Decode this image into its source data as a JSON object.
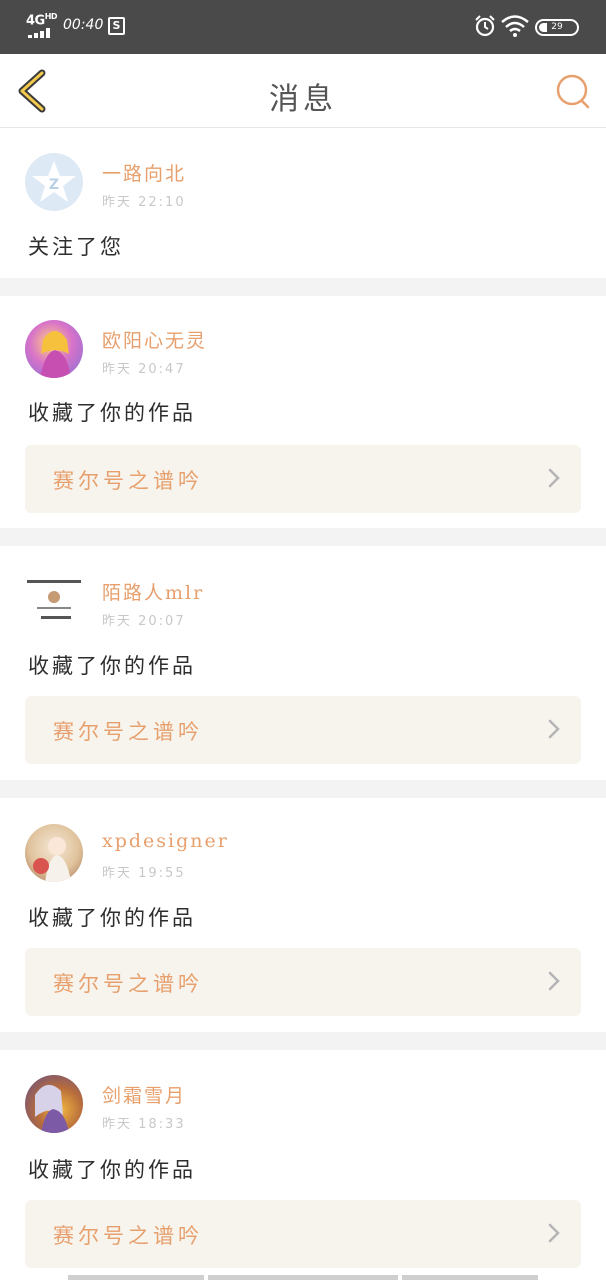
{
  "status_bar": {
    "network": "4G",
    "network_sup": "HD",
    "time": "00:40",
    "s_icon": "S",
    "battery": "29"
  },
  "nav": {
    "title": "消息",
    "back_icon": "chevron-left-icon",
    "search_icon": "search-icon"
  },
  "messages": [
    {
      "user": "一路向北",
      "time": "昨天 22:10",
      "action": "关注了您",
      "avatar_icon": "qzone-star-icon"
    },
    {
      "user": "欧阳心无灵",
      "time": "昨天 20:47",
      "action": "收藏了你的作品",
      "work": "赛尔号之谱吟"
    },
    {
      "user": "陌路人mlr",
      "time": "昨天 20:07",
      "action": "收藏了你的作品",
      "work": "赛尔号之谱吟"
    },
    {
      "user": "xpdesigner",
      "time": "昨天 19:55",
      "action": "收藏了你的作品",
      "work": "赛尔号之谱吟"
    },
    {
      "user": "剑霜雪月",
      "time": "昨天 18:33",
      "action": "收藏了你的作品",
      "work": "赛尔号之谱吟"
    }
  ],
  "colors": {
    "accent": "#e7a06d",
    "status_bar_bg": "#4a4a4a",
    "card_bg": "#f7f4ee",
    "separator": "#f3f3f3"
  }
}
